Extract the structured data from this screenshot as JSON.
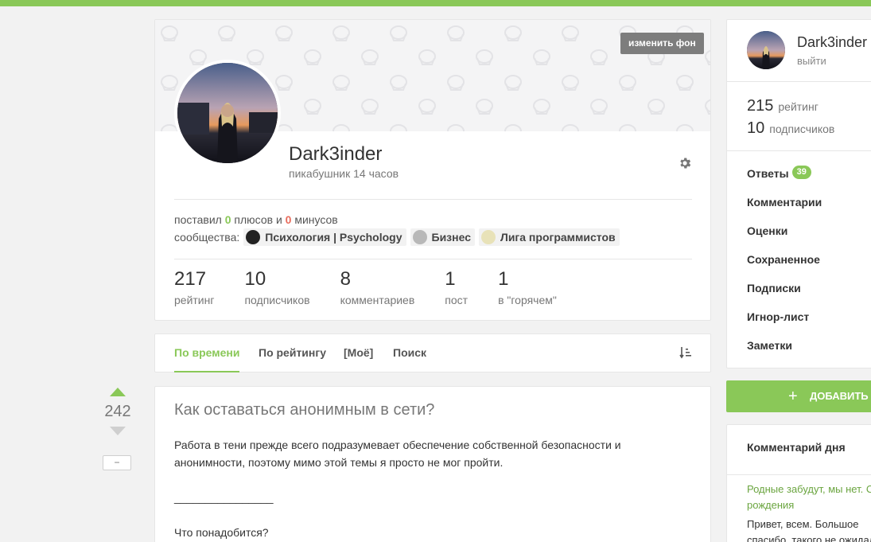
{
  "profile": {
    "change_background": "изменить фон",
    "username": "Dark3inder",
    "rank": "пикабушник 14 часов",
    "posted_prefix": "поставил ",
    "pluses": "0",
    "pluses_word": " плюсов и ",
    "minuses": "0",
    "minuses_word": " минусов",
    "communities_label": "сообщества:",
    "communities": [
      {
        "name": "Психология | Psychology",
        "icon": "head-gears-icon"
      },
      {
        "name": "Бизнес",
        "icon": "business-icon"
      },
      {
        "name": "Лига программистов",
        "icon": "programmers-league-icon"
      }
    ],
    "stats": [
      {
        "num": "217",
        "label": "рейтинг"
      },
      {
        "num": "10",
        "label": "подписчиков"
      },
      {
        "num": "8",
        "label": "комментариев"
      },
      {
        "num": "1",
        "label": "пост"
      },
      {
        "num": "1",
        "label": "в \"горячем\""
      }
    ]
  },
  "tabs": [
    {
      "label": "По времени",
      "active": true
    },
    {
      "label": "По рейтингу",
      "active": false
    },
    {
      "label": "[Моё]",
      "active": false
    },
    {
      "label": "Поиск",
      "active": false
    }
  ],
  "post": {
    "rating": "242",
    "hide_label": "−",
    "title": "Как оставаться анонимным в сети?",
    "paragraphs": [
      "Работа в тени прежде всего подразумевает обеспечение собственной безопасности и анонимности, поэтому мимо этой темы я просто не мог пройти.",
      "________________",
      "Что понадобится?"
    ]
  },
  "sidebar": {
    "username": "Dark3inder",
    "logout": "выйти",
    "rating_num": "215",
    "rating_label": "рейтинг",
    "subs_num": "10",
    "subs_label": "подписчиков",
    "menu": [
      {
        "label": "Ответы",
        "badge": "39"
      },
      {
        "label": "Комментарии"
      },
      {
        "label": "Оценки"
      },
      {
        "label": "Сохраненное"
      },
      {
        "label": "Подписки"
      },
      {
        "label": "Игнор-лист"
      },
      {
        "label": "Заметки"
      }
    ],
    "add_label": "ДОБАВИТЬ",
    "cotd_title": "Комментарий дня",
    "cotd_link": "Родные забудут, мы нет. С рождения",
    "cotd_text": "Привет, всем. Большое спасибо, такого не ожидал, мне очень"
  },
  "colors": {
    "accent": "#8ac858",
    "minus": "#e86c5c"
  }
}
